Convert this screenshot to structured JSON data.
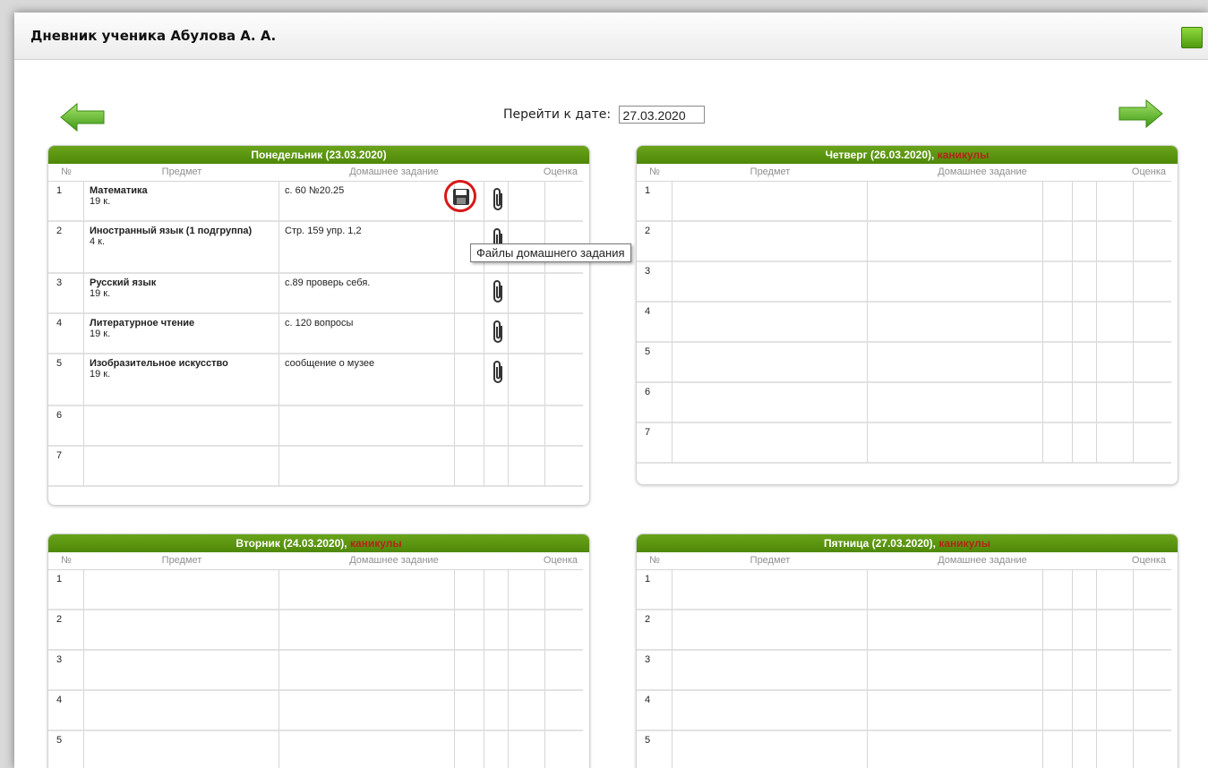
{
  "title": "Дневник ученика Абулова А. А.",
  "goto_label": "Перейти к дате:",
  "goto_date": "27.03.2020",
  "col_headers": {
    "num": "№",
    "subject": "Предмет",
    "homework": "Домашнее задание",
    "grade": "Оценка"
  },
  "tooltip": "Файлы домашнего задания",
  "holiday_label": "каникулы",
  "colors": {
    "header_green": "#5a9a12",
    "holiday_red": "#b3251a"
  },
  "days": [
    {
      "title": "Понедельник (23.03.2020)",
      "rows": [
        {
          "n": "1",
          "subject": "Математика",
          "room": "19 к.",
          "homework": "с. 60 №20.25",
          "files": true,
          "save": true
        },
        {
          "n": "2",
          "subject": "Иностранный язык (1 подгруппа)",
          "room": "4 к.",
          "homework": "Стр. 159 упр. 1,2",
          "files": true,
          "save": false
        },
        {
          "n": "3",
          "subject": "Русский язык",
          "room": "19 к.",
          "homework": "с.89 проверь себя.",
          "files": true,
          "save": false
        },
        {
          "n": "4",
          "subject": "Литературное чтение",
          "room": "19 к.",
          "homework": "с. 120 вопросы",
          "files": true,
          "save": false
        },
        {
          "n": "5",
          "subject": "Изобразительное искусство",
          "room": "19 к.",
          "homework": "сообщение о музее",
          "files": true,
          "save": false
        },
        {
          "n": "6",
          "subject": "",
          "room": "",
          "homework": "",
          "files": false,
          "save": false
        },
        {
          "n": "7",
          "subject": "",
          "room": "",
          "homework": "",
          "files": false,
          "save": false
        }
      ]
    },
    {
      "title": "Четверг (26.03.2020), ",
      "holiday": true,
      "rows": [
        {
          "n": "1"
        },
        {
          "n": "2"
        },
        {
          "n": "3"
        },
        {
          "n": "4"
        },
        {
          "n": "5"
        },
        {
          "n": "6"
        },
        {
          "n": "7"
        }
      ]
    },
    {
      "title": "Вторник (24.03.2020), ",
      "holiday": true,
      "rows": [
        {
          "n": "1"
        },
        {
          "n": "2"
        },
        {
          "n": "3"
        },
        {
          "n": "4"
        },
        {
          "n": "5"
        }
      ]
    },
    {
      "title": "Пятница (27.03.2020), ",
      "holiday": true,
      "rows": [
        {
          "n": "1"
        },
        {
          "n": "2"
        },
        {
          "n": "3"
        },
        {
          "n": "4"
        },
        {
          "n": "5"
        }
      ]
    }
  ]
}
